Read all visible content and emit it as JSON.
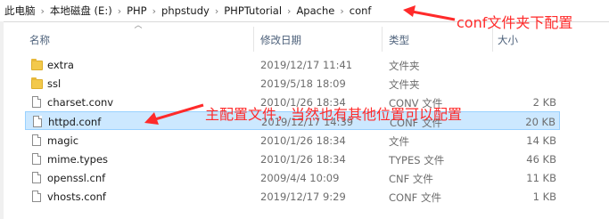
{
  "breadcrumb": [
    "此电脑",
    "本地磁盘 (E:)",
    "PHP",
    "phpstudy",
    "PHPTutorial",
    "Apache",
    "conf"
  ],
  "columns": {
    "name": "名称",
    "date": "修改日期",
    "type": "类型",
    "size": "大小"
  },
  "rows": [
    {
      "name": "extra",
      "date": "2019/12/17 11:41",
      "type": "文件夹",
      "size": "",
      "icon": "folder-icon"
    },
    {
      "name": "ssl",
      "date": "2019/5/18 18:09",
      "type": "文件夹",
      "size": "",
      "icon": "folder-icon"
    },
    {
      "name": "charset.conv",
      "date": "2010/1/26 18:34",
      "type": "CONV 文件",
      "size": "2 KB",
      "icon": "file-icon"
    },
    {
      "name": "httpd.conf",
      "date": "2019/12/17 14:39",
      "type": "CONF 文件",
      "size": "20 KB",
      "icon": "file-icon"
    },
    {
      "name": "magic",
      "date": "2010/1/26 18:34",
      "type": "文件",
      "size": "14 KB",
      "icon": "file-icon"
    },
    {
      "name": "mime.types",
      "date": "2010/1/26 18:34",
      "type": "TYPES 文件",
      "size": "46 KB",
      "icon": "file-icon"
    },
    {
      "name": "openssl.cnf",
      "date": "2009/4/4 10:09",
      "type": "CNF 文件",
      "size": "11 KB",
      "icon": "file-icon"
    },
    {
      "name": "vhosts.conf",
      "date": "2019/12/17 9:29",
      "type": "CONF 文件",
      "size": "1 KB",
      "icon": "file-icon"
    }
  ],
  "selected_row": "httpd.conf",
  "annotations": {
    "folder_note": "conf文件夹下配置",
    "file_note": "主配置文件，当然也有其他位置可以配置"
  },
  "colors": {
    "annotation": "#ff2a2a",
    "selection_bg": "#cce8ff",
    "selection_border": "#99d1ff",
    "header_text": "#4c607a"
  }
}
